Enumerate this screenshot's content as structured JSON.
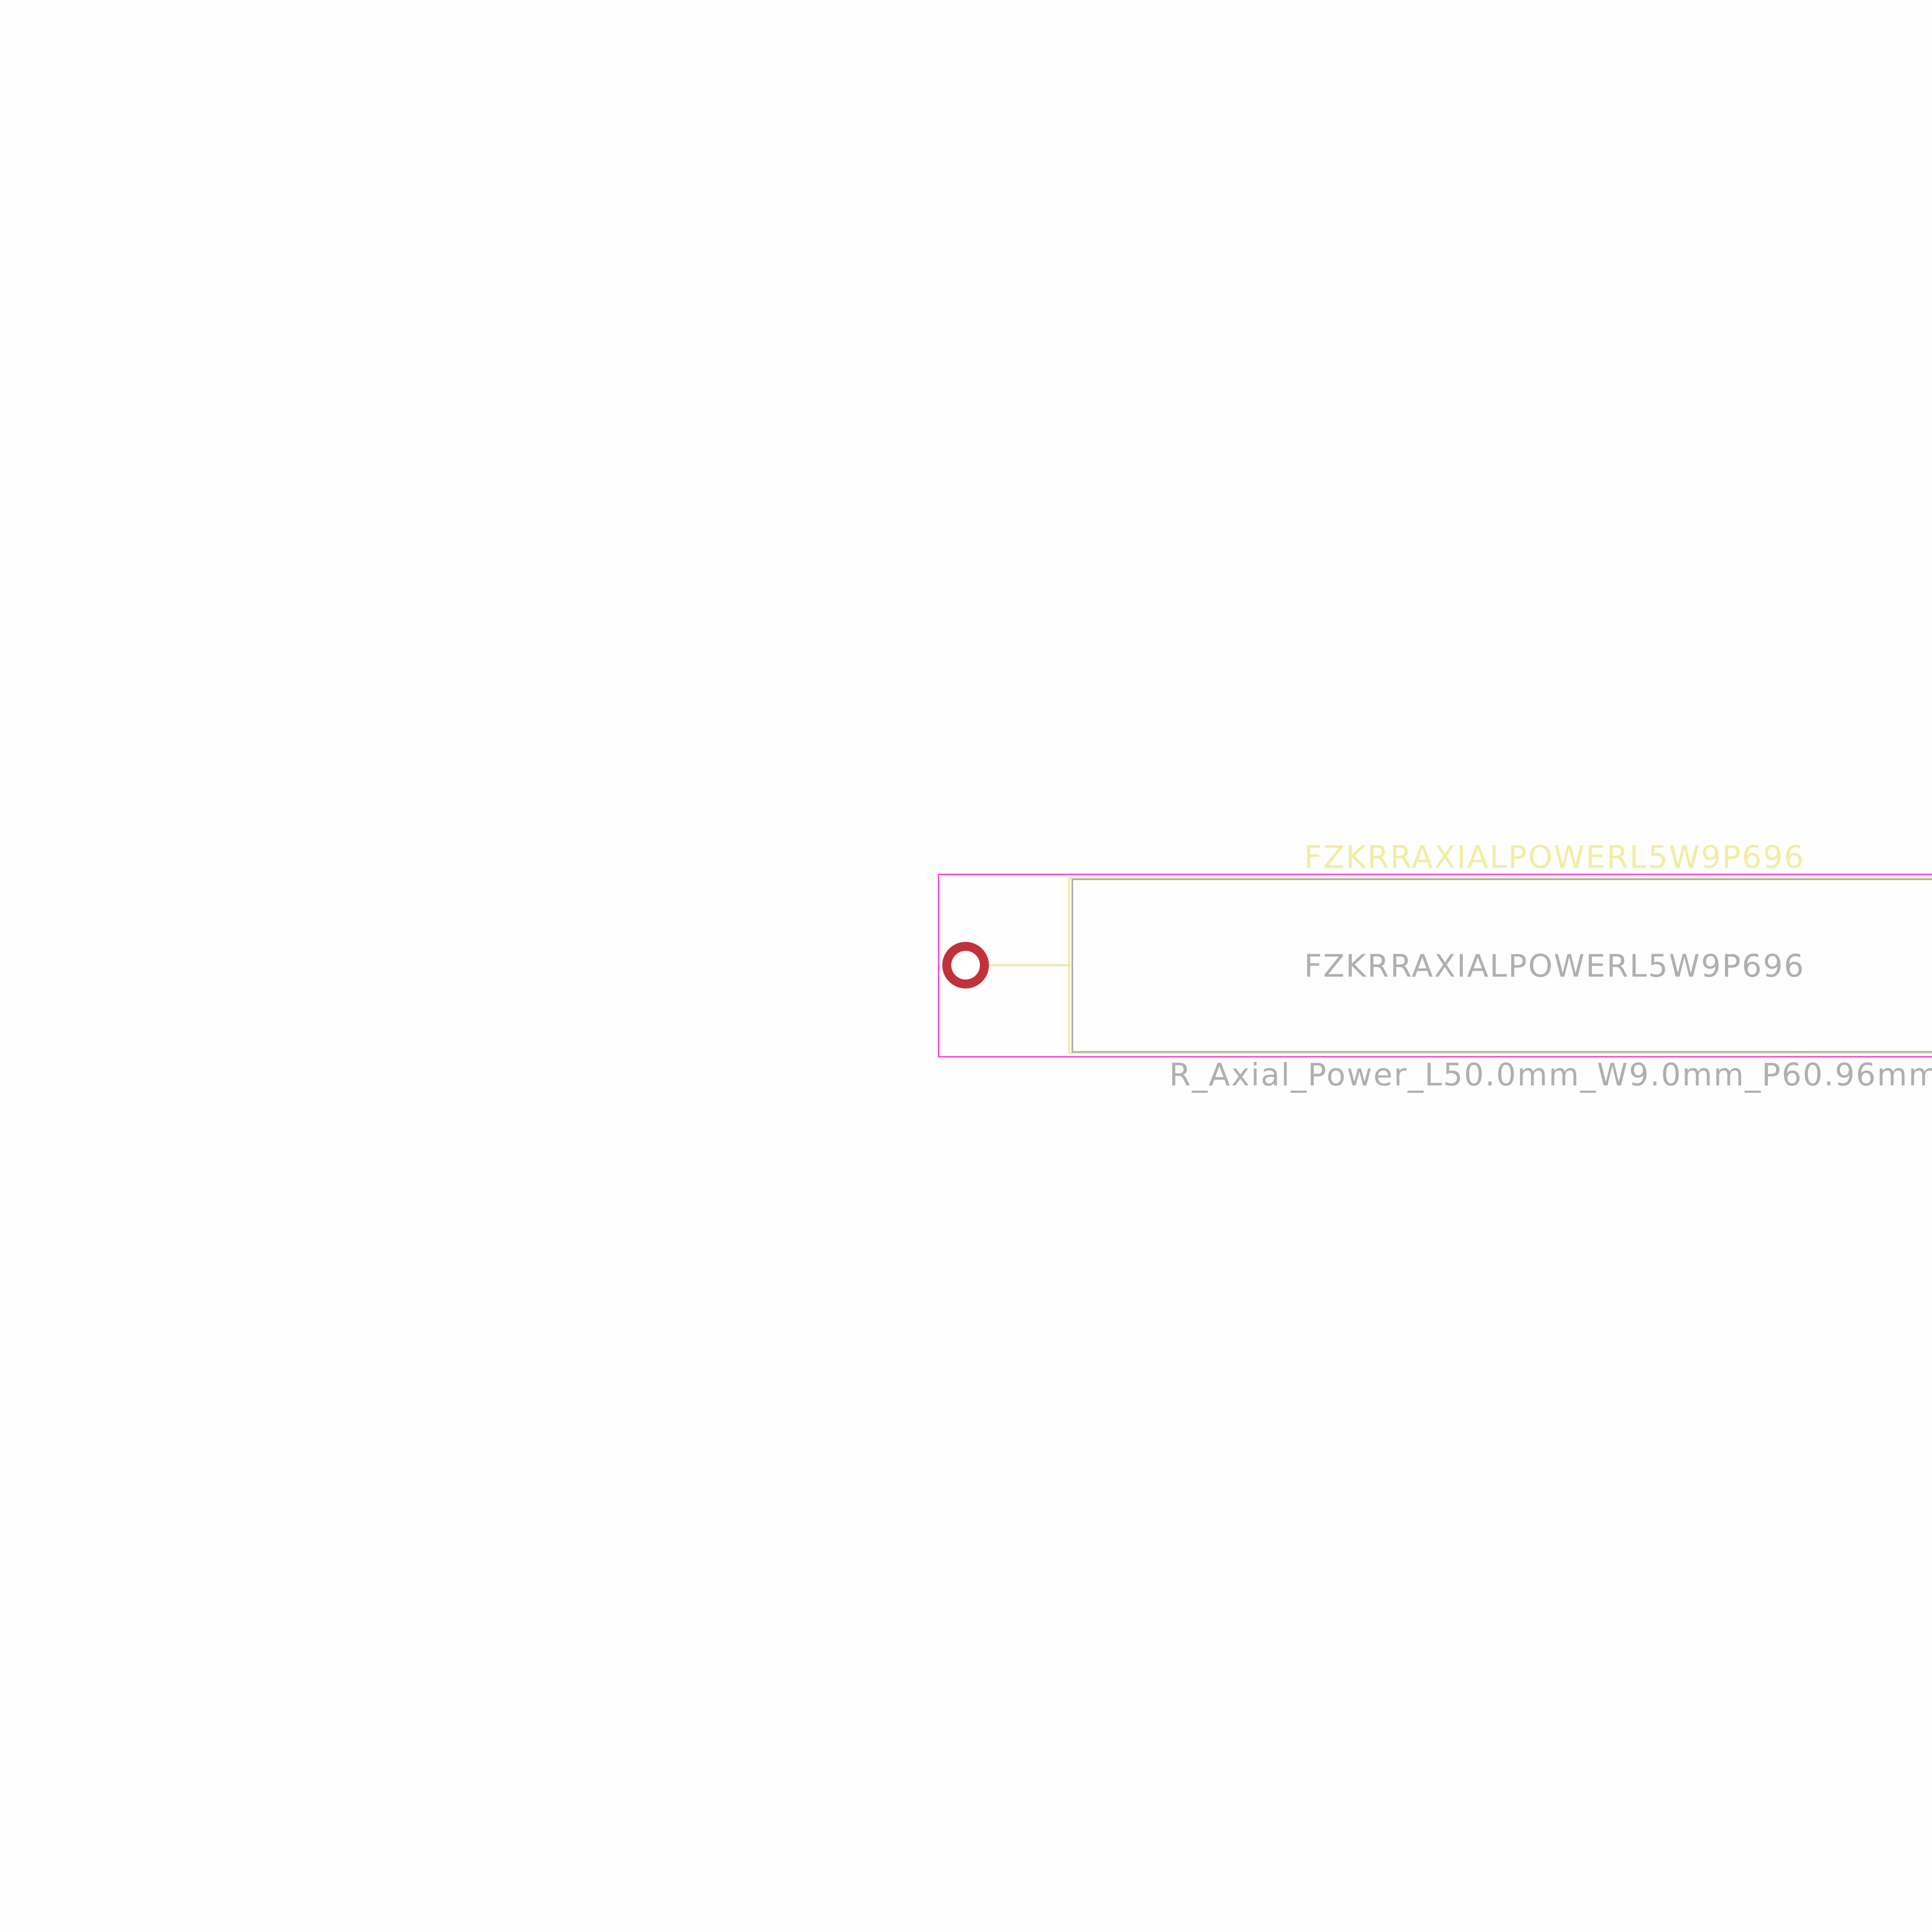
{
  "footprint": {
    "reference": "FZKRRAXIALPOWERL5W9P696",
    "value": "FZKRRAXIALPOWERL5W9P696",
    "name": "R_Axial_Power_L50.0mm_W9.0mm_P60.96mm"
  },
  "colors": {
    "background": "#fefefe",
    "courtyard": "#ff26e2",
    "silkscreen": "#f2eda1",
    "fabrication": "#afafaf",
    "pad": "#c2313a",
    "drill": "#ffffff"
  }
}
